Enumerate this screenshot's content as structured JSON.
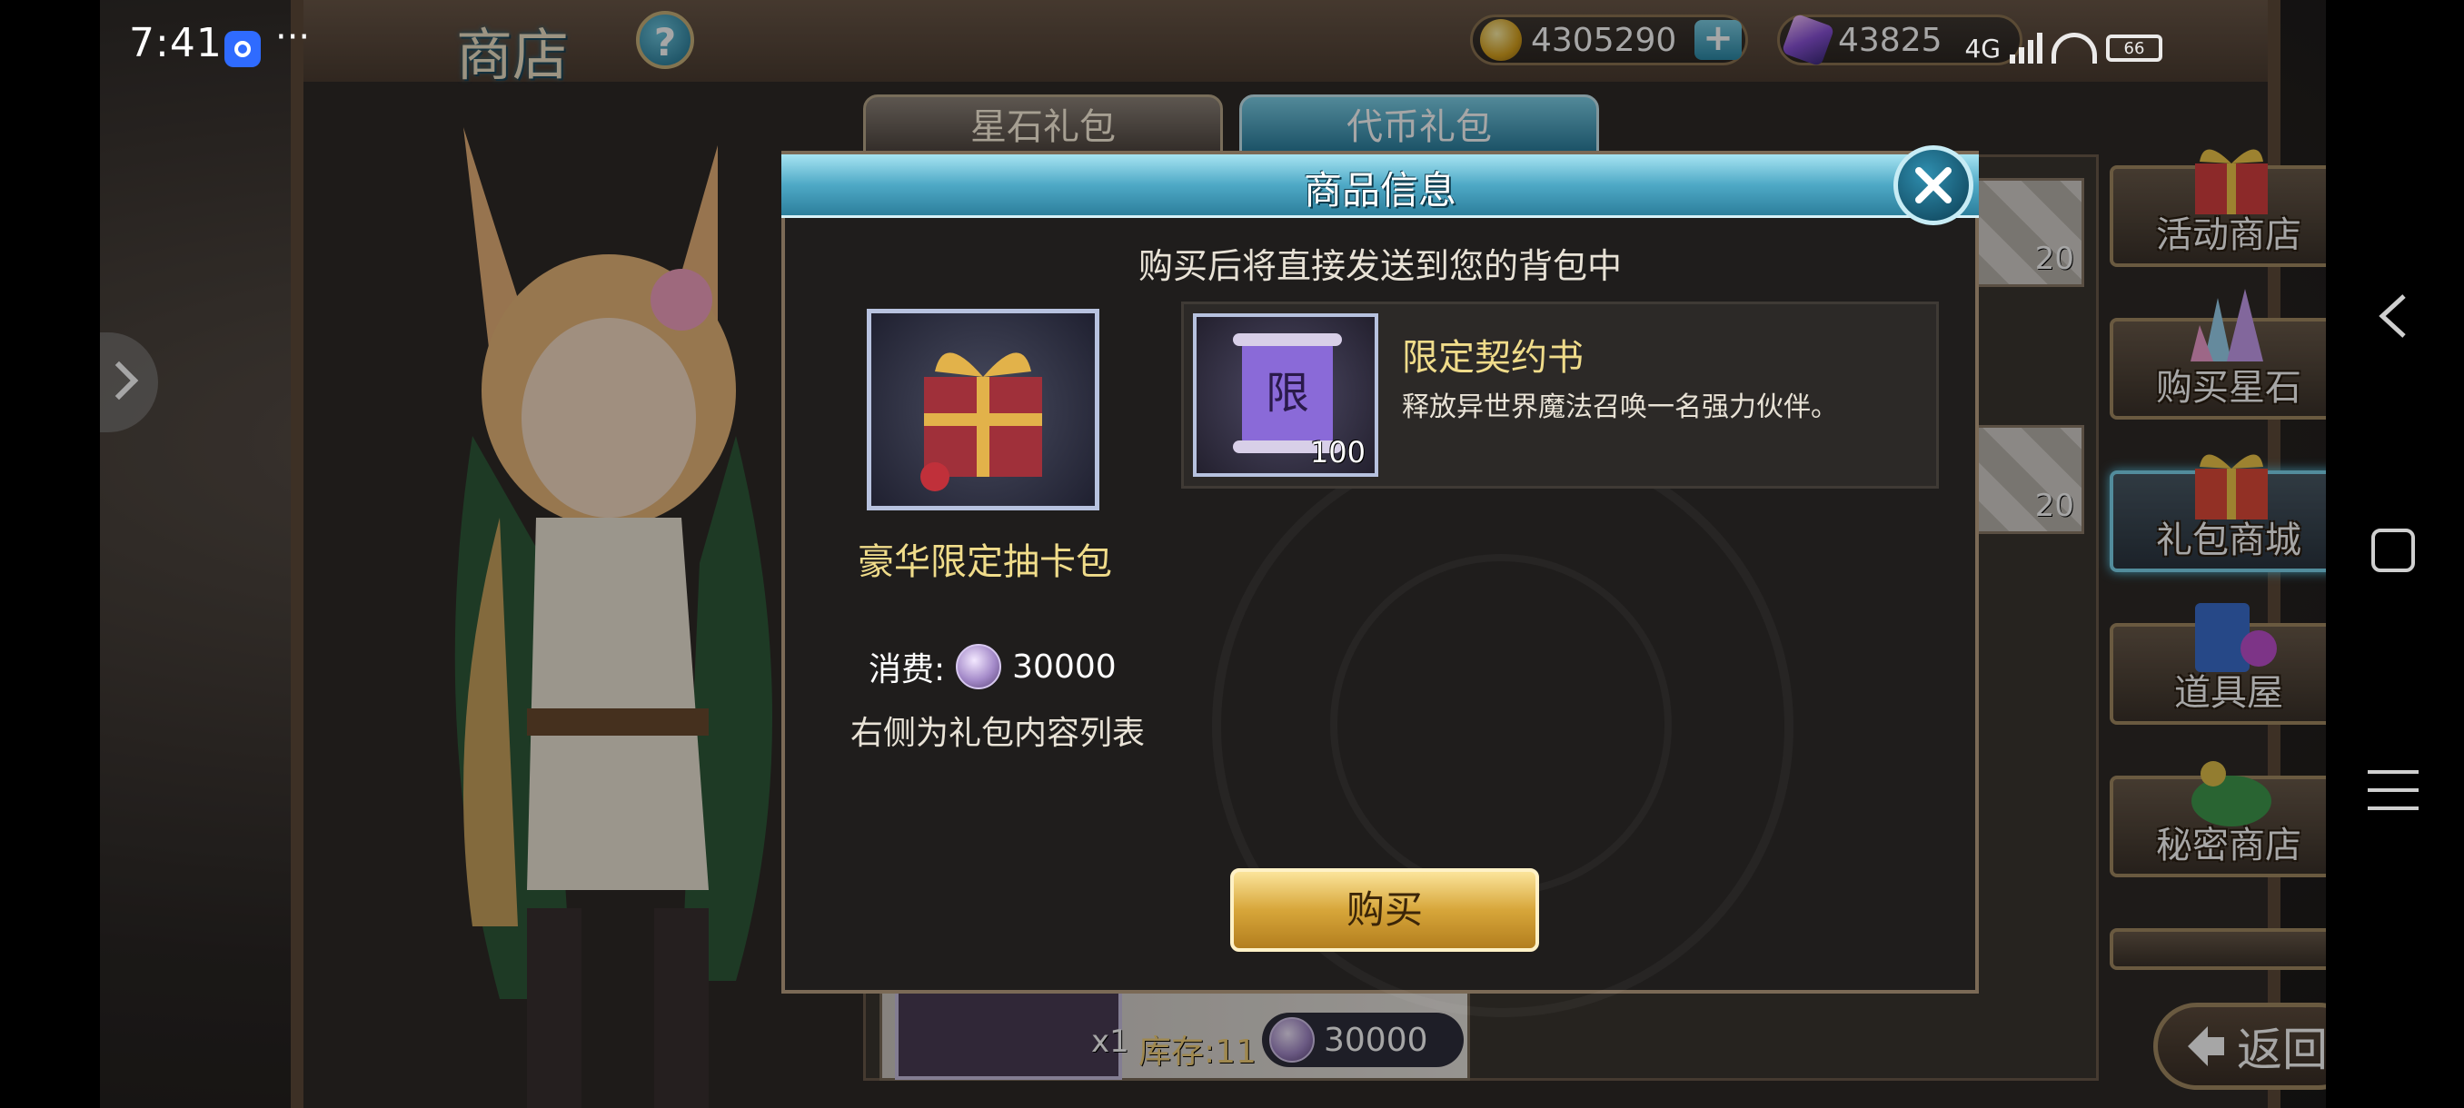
{
  "status_bar": {
    "time": "7:41",
    "dots": "···",
    "network": "4G",
    "battery": "66"
  },
  "header": {
    "shop_title": "商店",
    "help": "?",
    "gold": "4305290",
    "crystals": "43825"
  },
  "tabs": [
    {
      "label": "星石礼包",
      "active": false
    },
    {
      "label": "代币礼包",
      "active": true
    }
  ],
  "side_menu": [
    {
      "label": "活动商店",
      "active": false
    },
    {
      "label": "购买星石",
      "active": false
    },
    {
      "label": "礼包商城",
      "active": true
    },
    {
      "label": "道具屋",
      "active": false
    },
    {
      "label": "秘密商店",
      "active": false
    }
  ],
  "back_button": "返回",
  "background_list": {
    "peek_values": [
      "20",
      "20"
    ],
    "card_qty": "x1",
    "card_stock": "库存:11",
    "card_price": "30000"
  },
  "modal": {
    "title": "商品信息",
    "subtitle": "购买后将直接发送到您的背包中",
    "gift_name": "豪华限定抽卡包",
    "cost_label": "消费:",
    "cost_value": "30000",
    "list_note": "右侧为礼包内容列表",
    "items": [
      {
        "name": "限定契约书",
        "description": "释放异世界魔法召唤一名强力伙伴。",
        "quantity": "100",
        "scroll_glyph": "限"
      }
    ],
    "buy_label": "购买"
  },
  "colors": {
    "accent_cyan": "#4ea9c6",
    "gold_text": "#f0dc8a",
    "buy_gold": "#d7a63a"
  }
}
